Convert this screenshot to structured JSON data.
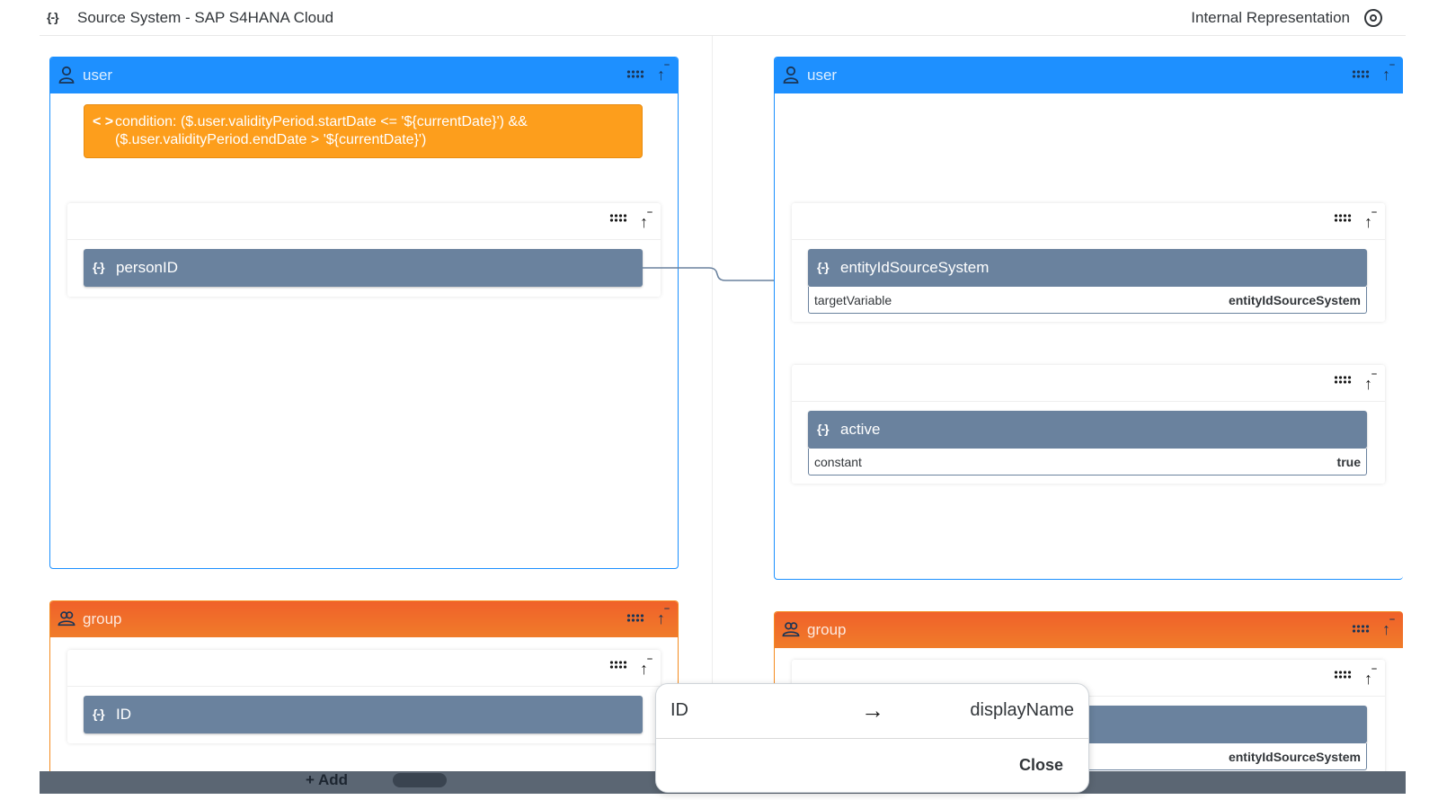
{
  "header": {
    "source_title": "Source System - SAP S4HANA Cloud",
    "target_title": "Internal Representation"
  },
  "source": {
    "user_panel": {
      "title": "user",
      "condition": "condition: ($.user.validityPeriod.startDate <= '${currentDate}') && ($.user.validityPeriod.endDate > '${currentDate}')",
      "field": "personID"
    },
    "group_panel": {
      "title": "group",
      "field": "ID"
    }
  },
  "target": {
    "user_panel": {
      "title": "user",
      "field1": {
        "name": "entityIdSourceSystem",
        "row_key": "targetVariable",
        "row_value": "entityIdSourceSystem"
      },
      "field2": {
        "name": "active",
        "row_key": "constant",
        "row_value": "true"
      }
    },
    "group_panel": {
      "title": "group",
      "field_row_value": "entityIdSourceSystem"
    }
  },
  "bottom_bar": {
    "add_label": "+ Add"
  },
  "popover": {
    "source": "ID",
    "target": "displayName",
    "close_label": "Close"
  },
  "colors": {
    "user_header": "#1e90ff",
    "group_header": "#f0612a",
    "condition_bg": "#fd9e1c",
    "field_bg": "#6a829e"
  }
}
